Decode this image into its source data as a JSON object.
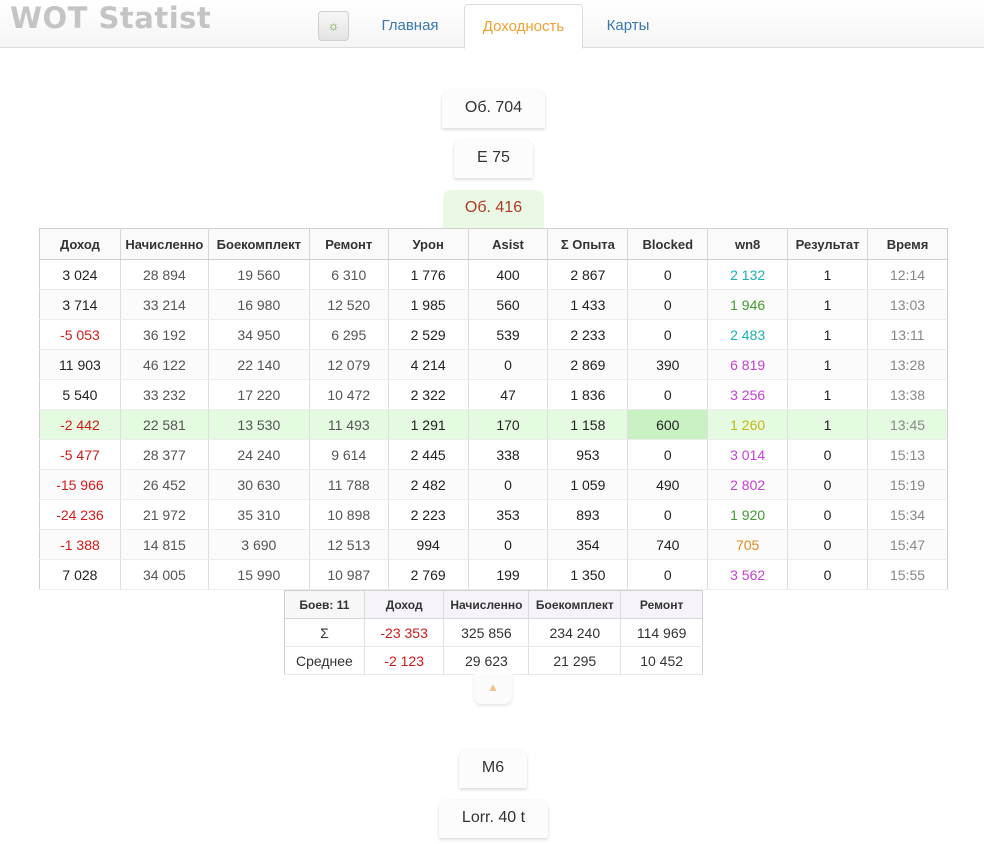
{
  "app": {
    "title": "WOT Statist"
  },
  "nav": {
    "settings_icon": "gear-icon",
    "tabs": [
      {
        "label": "Главная",
        "active": false
      },
      {
        "label": "Доходность",
        "active": true
      },
      {
        "label": "Карты",
        "active": false
      }
    ]
  },
  "tanks_top": [
    "Об. 704",
    "E 75"
  ],
  "active_tank": "Об. 416",
  "tanks_bottom": [
    "M6",
    "Lorr. 40 t"
  ],
  "table": {
    "headers": [
      "Доход",
      "Начисленно",
      "Боекомплект",
      "Ремонт",
      "Урон",
      "Asist",
      "Σ Опыта",
      "Blocked",
      "wn8",
      "Результат",
      "Время"
    ],
    "rows": [
      [
        "3 024",
        "28 894",
        "19 560",
        "6 310",
        "1 776",
        "400",
        "2 867",
        "0",
        "2 132",
        "1",
        "12:14"
      ],
      [
        "3 714",
        "33 214",
        "16 980",
        "12 520",
        "1 985",
        "560",
        "1 433",
        "0",
        "1 946",
        "1",
        "13:03"
      ],
      [
        "-5 053",
        "36 192",
        "34 950",
        "6 295",
        "2 529",
        "539",
        "2 233",
        "0",
        "2 483",
        "1",
        "13:11"
      ],
      [
        "11 903",
        "46 122",
        "22 140",
        "12 079",
        "4 214",
        "0",
        "2 869",
        "390",
        "6 819",
        "1",
        "13:28"
      ],
      [
        "5 540",
        "33 232",
        "17 220",
        "10 472",
        "2 322",
        "47",
        "1 836",
        "0",
        "3 256",
        "1",
        "13:38"
      ],
      [
        "-2 442",
        "22 581",
        "13 530",
        "11 493",
        "1 291",
        "170",
        "1 158",
        "600",
        "1 260",
        "1",
        "13:45"
      ],
      [
        "-5 477",
        "28 377",
        "24 240",
        "9 614",
        "2 445",
        "338",
        "953",
        "0",
        "3 014",
        "0",
        "15:13"
      ],
      [
        "-15 966",
        "26 452",
        "30 630",
        "11 788",
        "2 482",
        "0",
        "1 059",
        "490",
        "2 802",
        "0",
        "15:19"
      ],
      [
        "-24 236",
        "21 972",
        "35 310",
        "10 898",
        "2 223",
        "353",
        "893",
        "0",
        "1 920",
        "0",
        "15:34"
      ],
      [
        "-1 388",
        "14 815",
        "3 690",
        "12 513",
        "994",
        "0",
        "354",
        "740",
        "705",
        "0",
        "15:47"
      ],
      [
        "7 028",
        "34 005",
        "15 990",
        "10 987",
        "2 769",
        "199",
        "1 350",
        "0",
        "3 562",
        "0",
        "15:55"
      ]
    ],
    "wn8_colors": [
      "teal",
      "green",
      "teal",
      "purple",
      "purple",
      "yellow",
      "purple",
      "purple",
      "green",
      "orange",
      "purple"
    ],
    "highlighted_row": 5
  },
  "summary": {
    "headers": [
      "Боев: 11",
      "Доход",
      "Начисленно",
      "Боекомплект",
      "Ремонт"
    ],
    "rows": [
      [
        "Σ",
        "-23 353",
        "325 856",
        "234 240",
        "114 969"
      ],
      [
        "Среднее",
        "-2 123",
        "29 623",
        "21 295",
        "10 452"
      ]
    ]
  },
  "collapse_icon": "caret-up-icon",
  "colors": {
    "negative": "#d21a1a",
    "active_tab": "#f0a030",
    "link": "#3a79b0",
    "row_highlight": "#e4fbe1",
    "wn8_teal": "#19b2b2",
    "wn8_green": "#3f9d2f",
    "wn8_purple": "#c63fd6",
    "wn8_yellow": "#c4b514",
    "wn8_orange": "#e08a1e"
  }
}
